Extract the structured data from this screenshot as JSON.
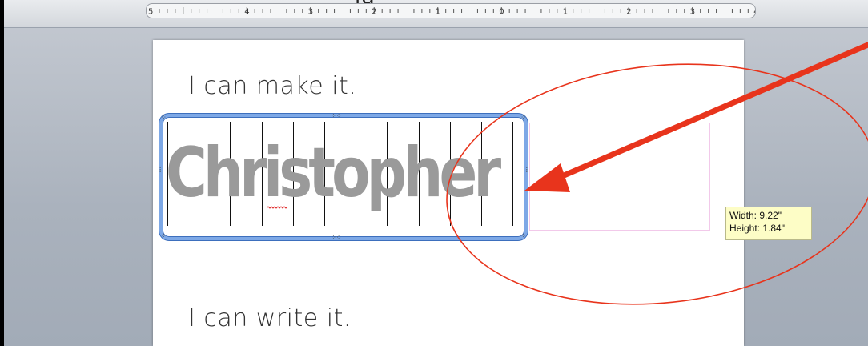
{
  "ruler": {
    "caption": "ig",
    "labels": [
      "5",
      "4",
      "3",
      "2",
      "1",
      "0",
      "1",
      "2",
      "3",
      "4"
    ]
  },
  "document": {
    "line1": "I can make it.",
    "line2": "I can write it.",
    "table_word": "Christopher"
  },
  "tooltip": {
    "width": "Width: 9.22\"",
    "height": "Height: 1.84\""
  },
  "colors": {
    "annotation_red": "#e8341c",
    "selection_blue": "#7da8e6",
    "word_gray": "#9a9a9a",
    "tooltip_bg": "#fdfdc6"
  },
  "icons": {
    "arrow": "red-arrow-icon",
    "circle": "red-ellipse-annotation"
  }
}
